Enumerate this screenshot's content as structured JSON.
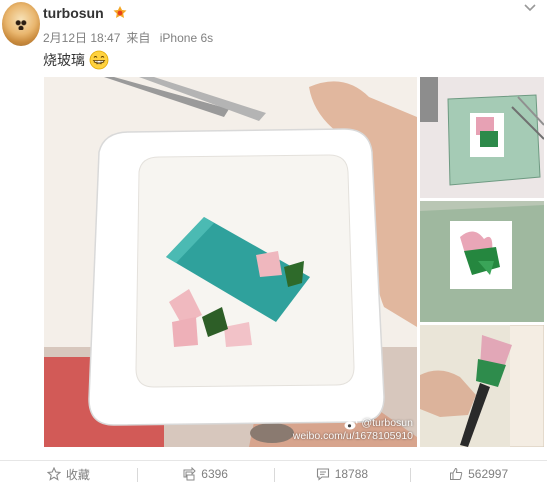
{
  "post": {
    "username": "turbosun",
    "timestamp": "2月12日 18:47",
    "source_prefix": "来自",
    "source_device": "iPhone 6s",
    "text": "烧玻璃",
    "emoji": "grinning-face-icon"
  },
  "watermark": {
    "handle": "@turbosun",
    "url": "weibo.com/u/1678105910"
  },
  "actions": {
    "favorite_label": "收藏",
    "repost_count": "6396",
    "comment_count": "18788",
    "like_count": "562997"
  },
  "icons": {
    "more": "chevron-down-icon",
    "favorite": "star-icon",
    "repost": "repost-icon",
    "comment": "comment-icon",
    "like": "thumbs-up-icon",
    "vip": "vip-badge-icon",
    "weibo": "weibo-logo-icon"
  },
  "colors": {
    "username": "#333333",
    "meta": "#808080",
    "badge": "#f5a623"
  }
}
